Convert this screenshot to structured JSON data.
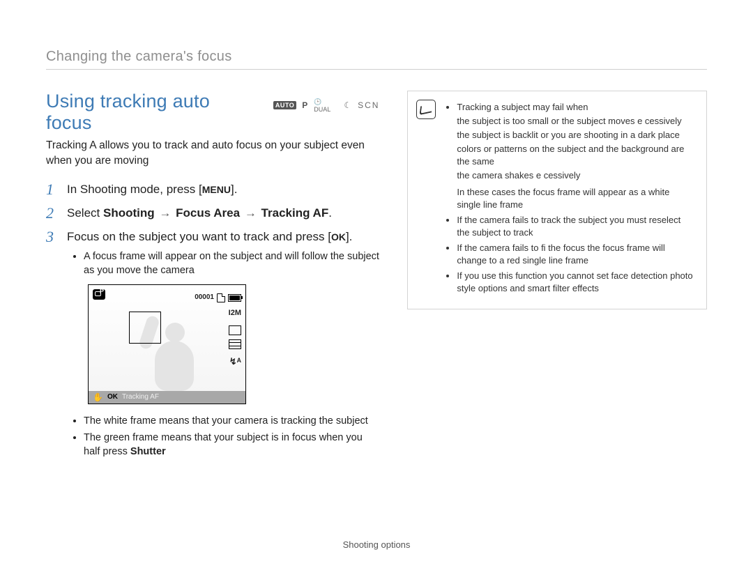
{
  "header": {
    "title": "Changing the camera's focus"
  },
  "section": {
    "title": "Using tracking auto focus",
    "modes": {
      "auto": "AUTO",
      "p": "P",
      "dual": "DUAL",
      "scn": "SCN"
    },
    "intro": "Tracking A  allows you to track and auto focus on your subject even when you are moving"
  },
  "steps": {
    "s1": {
      "num": "1",
      "pre": "In Shooting mode, press [",
      "key": "MENU",
      "post": "]."
    },
    "s2": {
      "num": "2",
      "pre": "Select ",
      "b1": "Shooting",
      "arrow": "→",
      "b2": "Focus Area",
      "b3": "Tracking AF",
      "post": "."
    },
    "s3": {
      "num": "3",
      "pre": "Focus on the subject you want to track and press [",
      "key": "OK",
      "post": "]."
    },
    "s3_sub1": "A focus frame will appear on the subject and will follow the subject as you move the camera",
    "post1": "The white frame means that your camera is tracking the subject",
    "post2_a": "The green frame means that your subject is in focus when you half press ",
    "post2_b": "Shutter"
  },
  "lcd": {
    "counter": "00001",
    "size": "I2M",
    "flash": "↯ᴬ",
    "ok": "OK",
    "label": "Tracking AF"
  },
  "note": {
    "l1": "Tracking a subject may fail when",
    "l1a": "the subject is too small or the subject moves e cessively",
    "l1b": "the subject is backlit or you are shooting in a dark place",
    "l1c": "colors or patterns on the subject and the background are the same",
    "l1d": "the camera shakes e cessively",
    "l1e": "In these cases  the focus frame will appear as a white single line frame",
    "l2": "If the camera fails to track the subject  you must reselect the subject to track",
    "l3": "If the camera fails to fi  the focus  the focus frame will change to a red single line frame",
    "l4": "If you use this function  you cannot set face detection  photo style options  and smart filter effects"
  },
  "footer": {
    "text": "Shooting options"
  }
}
